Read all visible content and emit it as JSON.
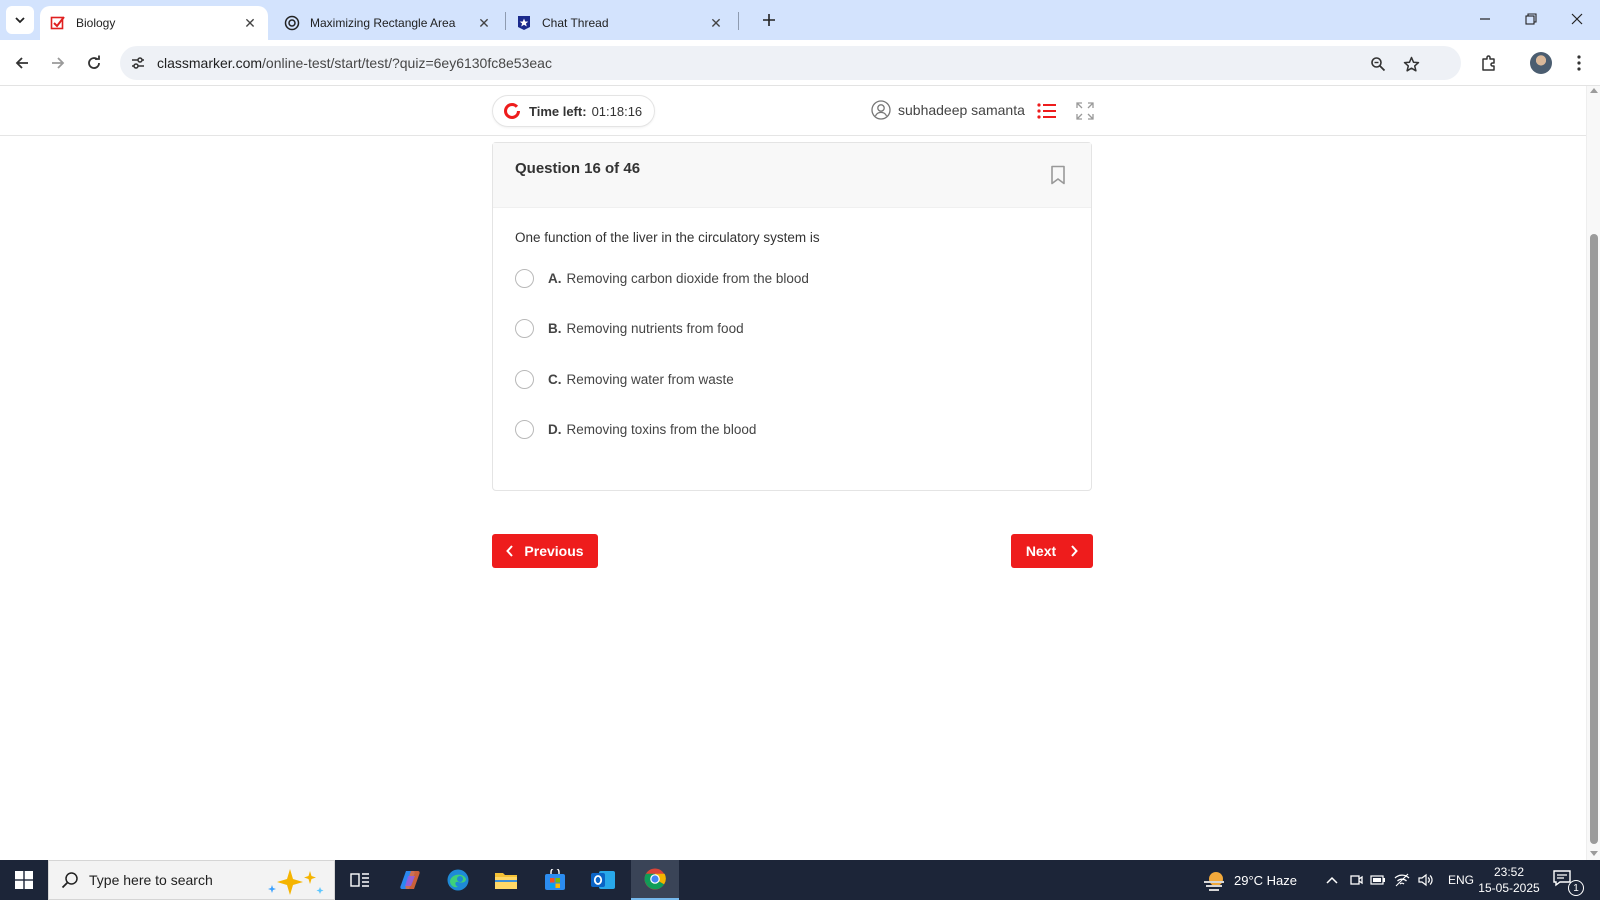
{
  "browser": {
    "tabs": [
      {
        "title": "Biology",
        "active": true,
        "icon": "classmarker-check-icon"
      },
      {
        "title": "Maximizing Rectangle Area",
        "active": false,
        "icon": "openai-icon"
      },
      {
        "title": "Chat Thread",
        "active": false,
        "icon": "star-badge-icon"
      }
    ],
    "url_host": "classmarker.com",
    "url_path": "/online-test/start/test/?quiz=6ey6130fc8e53eac"
  },
  "quiz": {
    "timer_label": "Time left:",
    "timer_value": "01:18:16",
    "user_name": "subhadeep samanta",
    "question_number": "Question 16 of 46",
    "question_text": "One function of the liver in the circulatory system is",
    "options": [
      {
        "letter": "A.",
        "text": "Removing carbon dioxide from the blood"
      },
      {
        "letter": "B.",
        "text": "Removing nutrients from food"
      },
      {
        "letter": "C.",
        "text": "Removing water from waste"
      },
      {
        "letter": "D.",
        "text": "Removing toxins from the blood"
      }
    ],
    "previous_label": "Previous",
    "next_label": "Next"
  },
  "taskbar": {
    "search_placeholder": "Type here to search",
    "weather": "29°C  Haze",
    "language": "ENG",
    "time": "23:52",
    "date": "15-05-2025",
    "notification_count": "1"
  },
  "colors": {
    "accent_red": "#ee1c1c",
    "tabstrip": "#d3e3fd",
    "taskbar": "#1c2538"
  }
}
